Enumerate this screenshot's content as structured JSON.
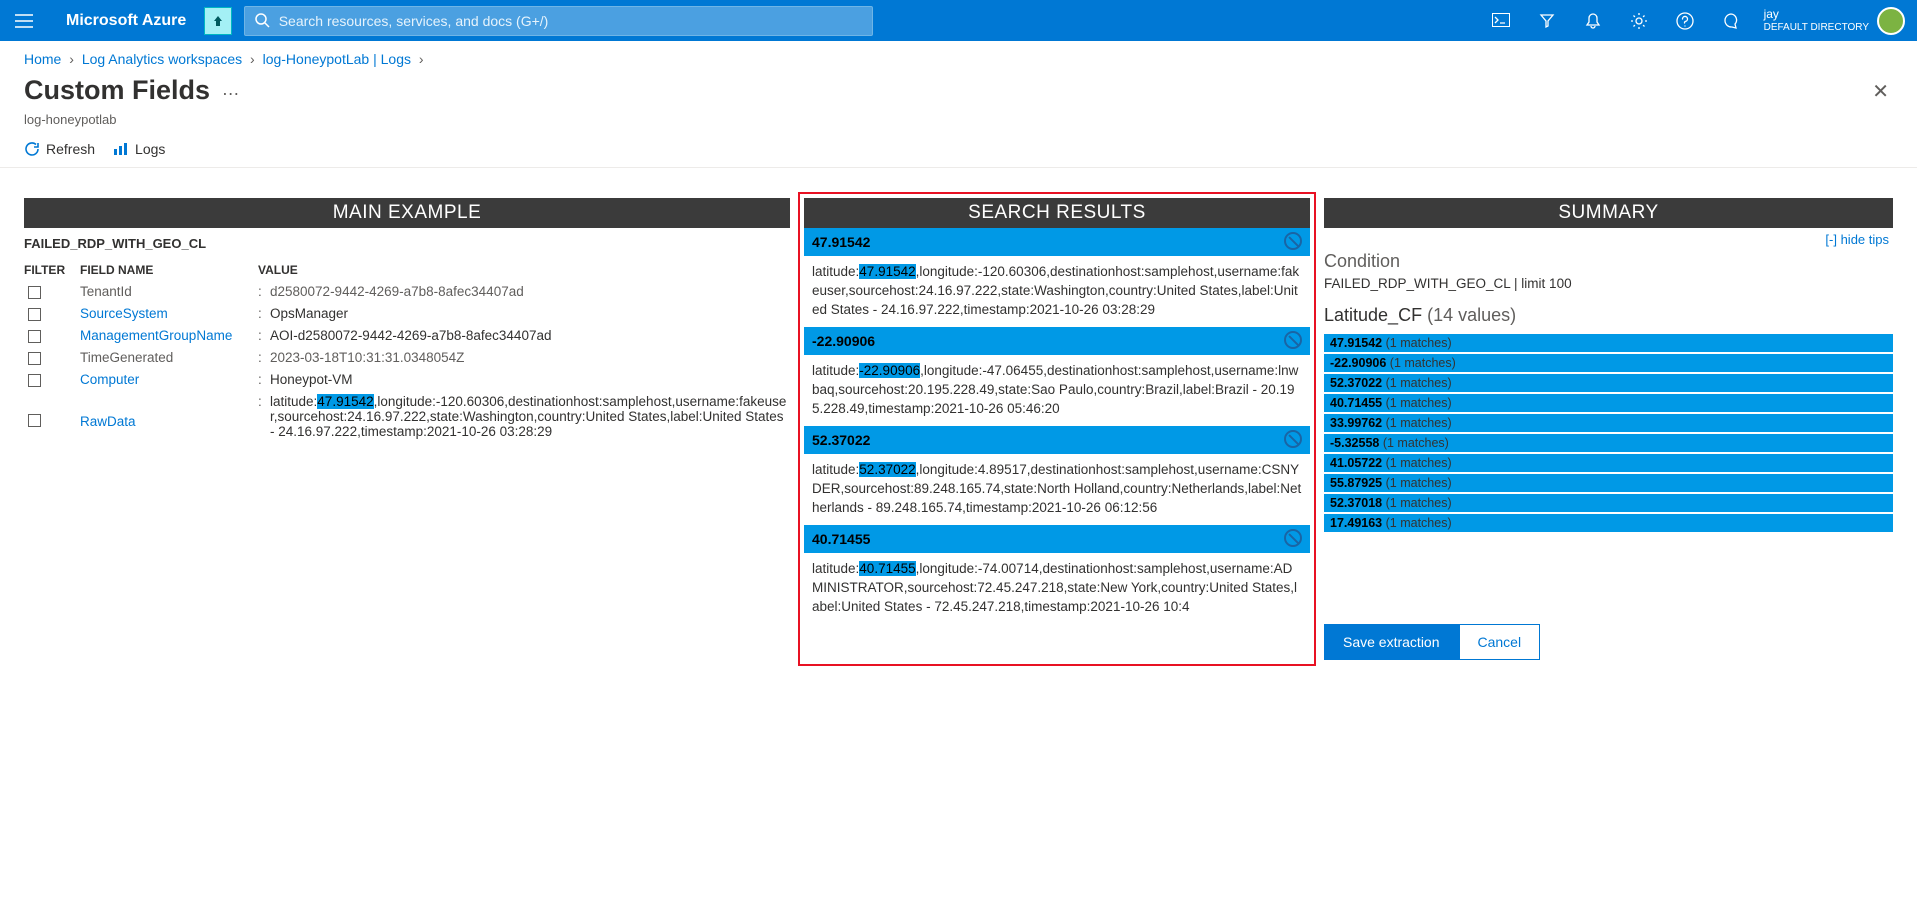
{
  "topbar": {
    "brand": "Microsoft Azure",
    "search_placeholder": "Search resources, services, and docs (G+/)",
    "account_name": "jay",
    "account_dir": "DEFAULT DIRECTORY"
  },
  "breadcrumb": [
    {
      "label": "Home"
    },
    {
      "label": "Log Analytics workspaces"
    },
    {
      "label": "log-HoneypotLab | Logs"
    }
  ],
  "page": {
    "title": "Custom Fields",
    "subtitle": "log-honeypotlab",
    "toolbar": {
      "refresh": "Refresh",
      "logs": "Logs"
    }
  },
  "main_example": {
    "header": "MAIN EXAMPLE",
    "record_type": "FAILED_RDP_WITH_GEO_CL",
    "th": {
      "filter": "FILTER",
      "field": "FIELD NAME",
      "value": "VALUE"
    },
    "rows": [
      {
        "field": "TenantId",
        "link": false,
        "muted": true,
        "value": "d2580072-9442-4269-a7b8-8afec34407ad",
        "valmuted": true
      },
      {
        "field": "SourceSystem",
        "link": true,
        "value": "OpsManager"
      },
      {
        "field": "ManagementGroupName",
        "link": true,
        "value": "AOI-d2580072-9442-4269-a7b8-8afec34407ad"
      },
      {
        "field": "TimeGenerated",
        "link": false,
        "muted": true,
        "value": "2023-03-18T10:31:31.0348054Z",
        "valmuted": true
      },
      {
        "field": "Computer",
        "link": true,
        "value": "Honeypot-VM"
      },
      {
        "field": "RawData",
        "link": true,
        "value_pre": "latitude:",
        "highlight": "47.91542",
        "value_post": ",longitude:-120.60306,destinationhost:samplehost,username:fakeuser,sourcehost:24.16.97.222,state:Washington,country:United States,label:United States - 24.16.97.222,timestamp:2021-10-26 03:28:29"
      }
    ]
  },
  "search_results": {
    "header": "SEARCH RESULTS",
    "items": [
      {
        "head": "47.91542",
        "pre": "latitude:",
        "hl": "47.91542",
        "post": ",longitude:-120.60306,destinationhost:samplehost,username:fakeuser,sourcehost:24.16.97.222,state:Washington,country:United States,label:United States - 24.16.97.222,timestamp:2021-10-26 03:28:29"
      },
      {
        "head": "-22.90906",
        "pre": "latitude:",
        "hl": "-22.90906",
        "post": ",longitude:-47.06455,destinationhost:samplehost,username:lnwbaq,sourcehost:20.195.228.49,state:Sao Paulo,country:Brazil,label:Brazil - 20.195.228.49,timestamp:2021-10-26 05:46:20"
      },
      {
        "head": "52.37022",
        "pre": "latitude:",
        "hl": "52.37022",
        "post": ",longitude:4.89517,destinationhost:samplehost,username:CSNYDER,sourcehost:89.248.165.74,state:North Holland,country:Netherlands,label:Netherlands - 89.248.165.74,timestamp:2021-10-26 06:12:56"
      },
      {
        "head": "40.71455",
        "pre": "latitude:",
        "hl": "40.71455",
        "post": ",longitude:-74.00714,destinationhost:samplehost,username:ADMINISTRATOR,sourcehost:72.45.247.218,state:New York,country:United States,label:United States - 72.45.247.218,timestamp:2021-10-26 10:4"
      }
    ]
  },
  "summary": {
    "header": "SUMMARY",
    "hide_tips": "[-] hide tips",
    "condition_label": "Condition",
    "condition_value": "FAILED_RDP_WITH_GEO_CL | limit 100",
    "field_name": "Latitude_CF",
    "field_count": "(14 values)",
    "bars": [
      {
        "v": "47.91542",
        "m": "(1 matches)"
      },
      {
        "v": "-22.90906",
        "m": "(1 matches)"
      },
      {
        "v": "52.37022",
        "m": "(1 matches)"
      },
      {
        "v": "40.71455",
        "m": "(1 matches)"
      },
      {
        "v": "33.99762",
        "m": "(1 matches)"
      },
      {
        "v": "-5.32558",
        "m": "(1 matches)"
      },
      {
        "v": "41.05722",
        "m": "(1 matches)"
      },
      {
        "v": "55.87925",
        "m": "(1 matches)"
      },
      {
        "v": "52.37018",
        "m": "(1 matches)"
      },
      {
        "v": "17.49163",
        "m": "(1 matches)"
      }
    ],
    "save": "Save extraction",
    "cancel": "Cancel"
  }
}
